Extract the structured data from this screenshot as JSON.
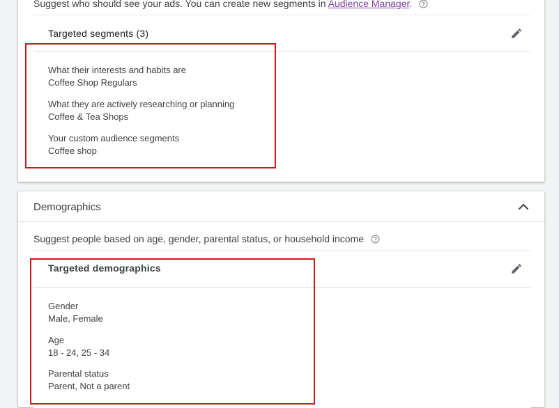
{
  "audience": {
    "intro_text": "Suggest who should see your ads.  You can create new segments in",
    "intro_link": "Audience Manager",
    "intro_end": ".",
    "segments_title": "Targeted segments (3)",
    "segments": [
      {
        "label": "What their interests and habits are",
        "value": "Coffee Shop Regulars"
      },
      {
        "label": "What they are actively researching or planning",
        "value": "Coffee & Tea Shops"
      },
      {
        "label": "Your custom audience segments",
        "value": "Coffee shop"
      }
    ]
  },
  "demographics": {
    "section_title": "Demographics",
    "intro_text": "Suggest people based on age, gender, parental status, or household income",
    "targeted_title": "Targeted demographics",
    "items": [
      {
        "label": "Gender",
        "value": "Male, Female"
      },
      {
        "label": "Age",
        "value": "18 - 24, 25 - 34"
      },
      {
        "label": "Parental status",
        "value": "Parent, Not a parent"
      }
    ]
  },
  "colors": {
    "highlight": "#d0161b",
    "link": "#7b3fa1",
    "background": "#f1f3f4"
  },
  "icons": [
    "help-circle-icon",
    "pencil-icon",
    "chevron-up-icon"
  ]
}
